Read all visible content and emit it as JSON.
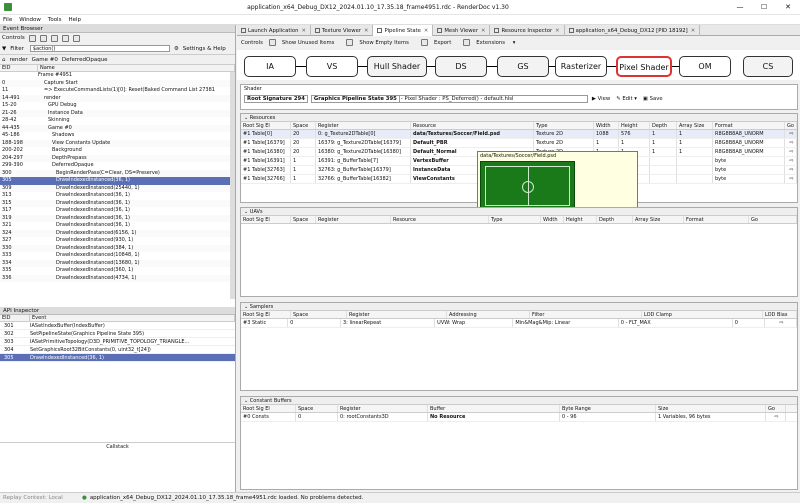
{
  "window": {
    "title": "application_x64_Debug_DX12_2024.01.10_17.35.18_frame4951.rdc - RenderDoc v1.30",
    "min": "—",
    "max": "☐",
    "close": "✕"
  },
  "menu": [
    "File",
    "Window",
    "Tools",
    "Help"
  ],
  "event_browser": {
    "title": "Event Browser",
    "controls": "Controls",
    "filter_label": "Filter",
    "filter_value": "$action()",
    "settings": "Settings & Help",
    "breadcrumb": [
      "render",
      "Game #0",
      "DeferredOpaque"
    ],
    "col_eid": "EID",
    "col_name": "Name",
    "rows": [
      {
        "eid": "",
        "name": "Frame #4951"
      },
      {
        "eid": "0",
        "name": "Capture Start"
      },
      {
        "eid": "11",
        "name": "=> ExecuteCommandLists(1)[0]: Reset(Baked Command List 27381"
      },
      {
        "eid": "14-491",
        "name": "render"
      },
      {
        "eid": "15-20",
        "name": "GPU Debug"
      },
      {
        "eid": "21-26",
        "name": "Instance Data"
      },
      {
        "eid": "28-42",
        "name": "Skinning"
      },
      {
        "eid": "44-435",
        "name": "Game #0"
      },
      {
        "eid": "45-186",
        "name": "Shadows"
      },
      {
        "eid": "188-198",
        "name": "View Constants Update"
      },
      {
        "eid": "200-202",
        "name": "Background"
      },
      {
        "eid": "204-297",
        "name": "DepthPrepass"
      },
      {
        "eid": "299-390",
        "name": "DeferredOpaque"
      },
      {
        "eid": "300",
        "name": "BeginRenderPass(C=Clear, DS=Preserve)"
      },
      {
        "eid": "305",
        "name": "DrawIndexedInstanced(36, 1)"
      },
      {
        "eid": "309",
        "name": "DrawIndexedInstanced(25440, 1)"
      },
      {
        "eid": "313",
        "name": "DrawIndexedInstanced(36, 1)"
      },
      {
        "eid": "315",
        "name": "DrawIndexedInstanced(36, 1)"
      },
      {
        "eid": "317",
        "name": "DrawIndexedInstanced(36, 1)"
      },
      {
        "eid": "319",
        "name": "DrawIndexedInstanced(36, 1)"
      },
      {
        "eid": "321",
        "name": "DrawIndexedInstanced(36, 1)"
      },
      {
        "eid": "324",
        "name": "DrawIndexedInstanced(6156, 1)"
      },
      {
        "eid": "327",
        "name": "DrawIndexedInstanced(930, 1)"
      },
      {
        "eid": "330",
        "name": "DrawIndexedInstanced(384, 1)"
      },
      {
        "eid": "333",
        "name": "DrawIndexedInstanced(10848, 1)"
      },
      {
        "eid": "334",
        "name": "DrawIndexedInstanced(13680, 1)"
      },
      {
        "eid": "335",
        "name": "DrawIndexedInstanced(360, 1)"
      },
      {
        "eid": "336",
        "name": "DrawIndexedInstanced(4734, 1)"
      }
    ],
    "selected_eid": "305"
  },
  "api_inspector": {
    "title": "API Inspector",
    "col_eid": "EID",
    "col_event": "Event",
    "rows": [
      {
        "eid": "301",
        "event": "IASetIndexBuffer(IndexBuffer)"
      },
      {
        "eid": "302",
        "event": "SetPipelineState(Graphics Pipeline State 395)"
      },
      {
        "eid": "303",
        "event": "IASetPrimitiveTopology(D3D_PRIMITIVE_TOPOLOGY_TRIANGLE..."
      },
      {
        "eid": "304",
        "event": "SetGraphicsRoot32BitConstants(0, uint32_t[24])"
      },
      {
        "eid": "305",
        "event": "DrawIndexedInstanced(36, 1)"
      }
    ],
    "callstack": "Callstack"
  },
  "tabs": [
    {
      "label": "Launch Application",
      "active": false
    },
    {
      "label": "Texture Viewer",
      "active": false
    },
    {
      "label": "Pipeline State",
      "active": true
    },
    {
      "label": "Mesh Viewer",
      "active": false
    },
    {
      "label": "Resource Inspector",
      "active": false
    },
    {
      "label": "application_x64_Debug_DX12 [PID 18192]",
      "active": false
    }
  ],
  "pipe_toolbar": {
    "controls": "Controls",
    "unused": "Show Unused Items",
    "empty": "Show Empty Items",
    "export": "Export",
    "extensions": "Extensions"
  },
  "stages": [
    {
      "label": "IA",
      "state": "on"
    },
    {
      "label": "VS",
      "state": "on"
    },
    {
      "label": "Hull Shader",
      "state": "off"
    },
    {
      "label": "DS",
      "state": "off"
    },
    {
      "label": "GS",
      "state": "off"
    },
    {
      "label": "Rasterizer",
      "state": "on"
    },
    {
      "label": "Pixel Shader",
      "state": "sel"
    },
    {
      "label": "OM",
      "state": "on"
    },
    {
      "label": "CS",
      "state": "off"
    }
  ],
  "shader": {
    "title": "Shader",
    "root_sig": "Root Signature 294",
    "pso": "Graphics Pipeline State 395",
    "ps_text": " - Pixel Shader : PS_Deferred() - default.hlsl",
    "view": "View",
    "edit": "Edit",
    "save": "Save"
  },
  "resources": {
    "title": "Resources",
    "cols": [
      "Root Sig El",
      "Space",
      "Register",
      "Resource",
      "Type",
      "Width",
      "Height",
      "Depth",
      "Array Size",
      "Format",
      "Go"
    ],
    "rows": [
      [
        "#1 Table[0]",
        "20",
        "0: g_Texture2DTable[0]",
        "data/Textures/Soccer/Field.psd",
        "Texture 2D",
        "1088",
        "576",
        "1",
        "1",
        "R8G8B8A8_UNORM"
      ],
      [
        "#1 Table[16379]",
        "20",
        "16379: g_Texture2DTable[16379]",
        "Default_PBR",
        "Texture 2D",
        "1",
        "1",
        "1",
        "1",
        "R8G8B8A8_UNORM"
      ],
      [
        "#1 Table[16380]",
        "20",
        "16380: g_Texture2DTable[16380]",
        "Default_Normal",
        "Texture 2D",
        "1",
        "1",
        "1",
        "1",
        "R8G8B8A8_UNORM"
      ],
      [
        "#1 Table[16391]",
        "1",
        "16391: g_BufferTable[7]",
        "VertexBuffer",
        "",
        "",
        "",
        "",
        "",
        "byte"
      ],
      [
        "#1 Table[32763]",
        "1",
        "32763: g_BufferTable[16379]",
        "InstanceData",
        "",
        "",
        "",
        "",
        "",
        "byte"
      ],
      [
        "#1 Table[32766]",
        "1",
        "32766: g_BufferTable[16382]",
        "ViewConstants",
        "",
        "",
        "",
        "",
        "",
        "byte"
      ]
    ]
  },
  "tooltip": {
    "title": "data/Textures/Soccer/Field.psd",
    "state": "Texture is in the 'D3D12_RESOURCE_STATE_GENERIC_READ' state"
  },
  "uavs": {
    "title": "UAVs",
    "cols": [
      "Root Sig El",
      "Space",
      "Register",
      "Resource",
      "Type",
      "Width",
      "Height",
      "Depth",
      "Array Size",
      "Format",
      "Go"
    ]
  },
  "samplers": {
    "title": "Samplers",
    "cols": [
      "Root Sig El",
      "Space",
      "Register",
      "Addressing",
      "Filter",
      "LOD Clamp",
      "LOD Bias"
    ],
    "rows": [
      [
        "#3 Static",
        "0",
        "3: linearRepeat",
        "UVW: Wrap",
        "Min&Mag&Mip: Linear",
        "0 - FLT_MAX",
        "0"
      ]
    ]
  },
  "cbuffers": {
    "title": "Constant Buffers",
    "cols": [
      "Root Sig El",
      "Space",
      "Register",
      "Buffer",
      "Byte Range",
      "Size",
      "Go"
    ],
    "rows": [
      [
        "#0 Consts",
        "0",
        "0: rootConstants3D",
        "No Resource",
        "0 - 96",
        "1 Variables, 96 bytes"
      ]
    ]
  },
  "status": {
    "replay": "Replay Context: Local",
    "message": "application_x64_Debug_DX12_2024.01.10_17.35.18_frame4951.rdc loaded. No problems detected."
  }
}
